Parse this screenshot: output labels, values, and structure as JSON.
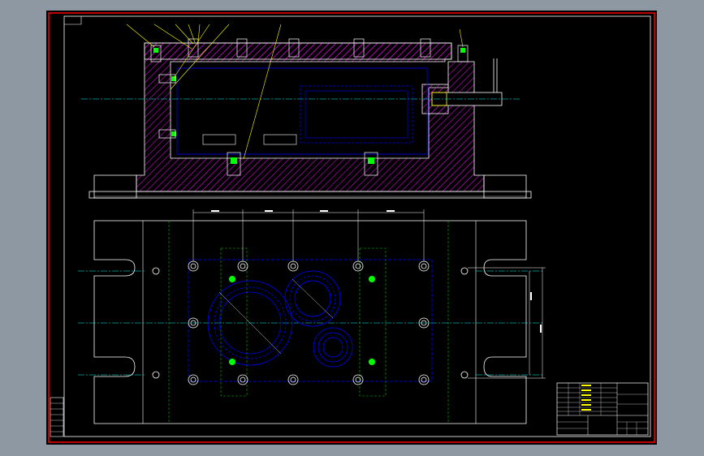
{
  "colors": {
    "background": "#8e98a3",
    "canvas": "#000000",
    "frame": "#ff0000",
    "outline": "#ffffff",
    "hidden_line": "#0000ff",
    "hatch": "#ff00ff",
    "center_line": "#00ffff",
    "leader": "#ffff00",
    "bolt_head": "#00ff00",
    "guide_line": "#00c000"
  },
  "icons": {
    "bolt_symbol": "hex-bolt-icon",
    "pin_symbol": "locating-pin-icon"
  }
}
